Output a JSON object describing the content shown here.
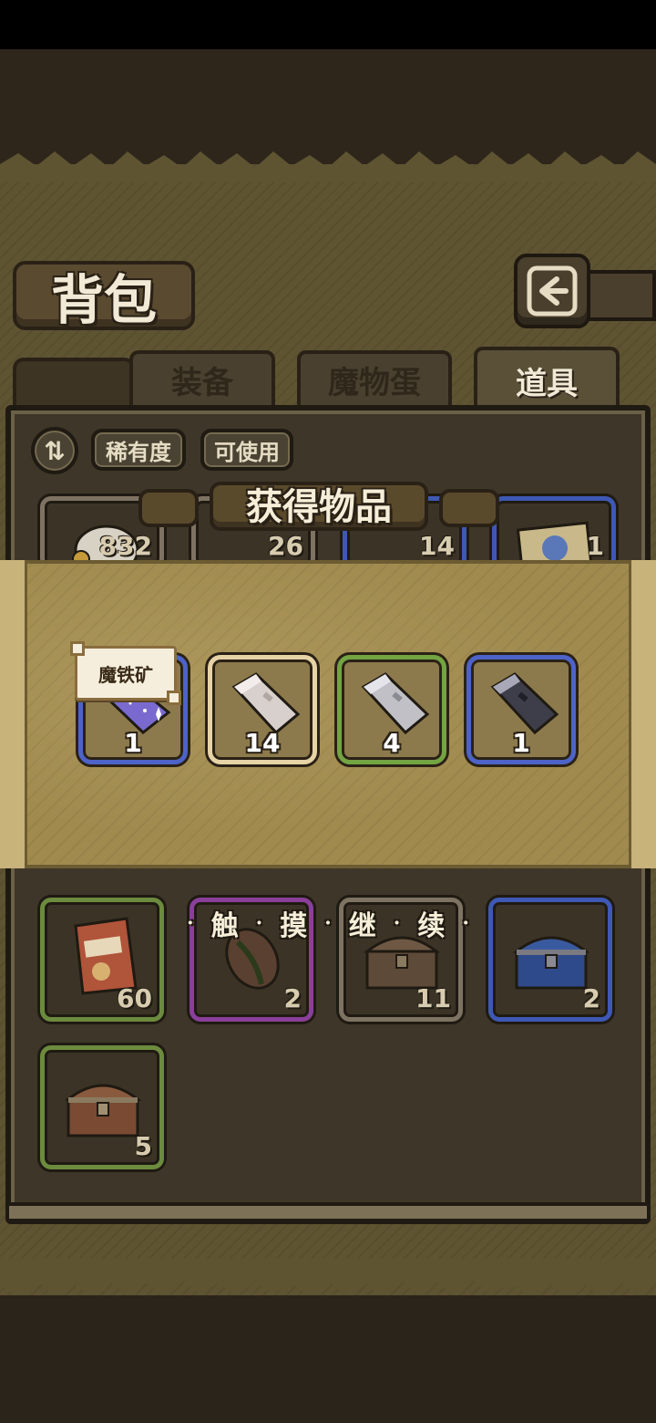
{
  "header": {
    "title": "背包"
  },
  "tabs": [
    {
      "label": "装备",
      "active": false
    },
    {
      "label": "魔物蛋",
      "active": false
    },
    {
      "label": "道具",
      "active": true
    }
  ],
  "filters": {
    "rarity_label": "稀有度",
    "usable_label": "可使用"
  },
  "peek_counts": [
    "832",
    "26",
    "14",
    "1"
  ],
  "popup": {
    "title": "获得物品",
    "tooltip": "魔铁矿",
    "rewards": [
      {
        "count": "1",
        "rarity": "blue",
        "icon": "magic-iron-ore-icon"
      },
      {
        "count": "14",
        "rarity": "beige",
        "icon": "stone-ore-icon"
      },
      {
        "count": "4",
        "rarity": "green",
        "icon": "iron-ore-icon"
      },
      {
        "count": "1",
        "rarity": "blue",
        "icon": "dark-ore-icon"
      }
    ],
    "continue_chars": [
      "触",
      "摸",
      "继",
      "续"
    ]
  },
  "inventory": [
    {
      "count": "60",
      "rarity": "green",
      "icon": "snack-bag-icon"
    },
    {
      "count": "2",
      "rarity": "purple",
      "icon": "seed-icon"
    },
    {
      "count": "11",
      "rarity": "gray",
      "icon": "wooden-chest-icon"
    },
    {
      "count": "2",
      "rarity": "blue",
      "icon": "blue-chest-icon"
    },
    {
      "count": "5",
      "rarity": "green",
      "icon": "treasure-chest-icon"
    }
  ],
  "colors": {
    "rarity_green": "#6c8b3e",
    "rarity_purple": "#8a3f9a",
    "rarity_blue": "#3e58b4",
    "rarity_gray": "#7e7362",
    "rarity_beige": "#e6d3a6"
  }
}
